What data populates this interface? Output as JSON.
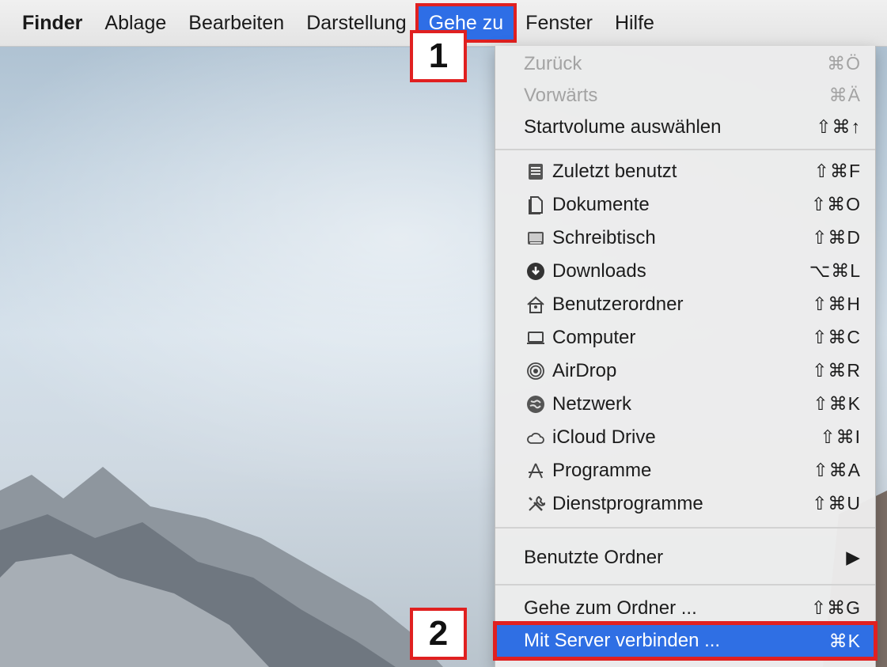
{
  "menubar": {
    "app_name": "Finder",
    "items": [
      "Ablage",
      "Bearbeiten",
      "Darstellung"
    ],
    "active_item": "Gehe zu",
    "items_after": [
      "Fenster",
      "Hilfe"
    ]
  },
  "callouts": {
    "step1": "1",
    "step2": "2"
  },
  "menu": {
    "nav": [
      {
        "label": "Zurück",
        "shortcut": "⌘Ö",
        "enabled": false
      },
      {
        "label": "Vorwärts",
        "shortcut": "⌘Ä",
        "enabled": false
      },
      {
        "label": "Startvolume auswählen",
        "shortcut": "⇧⌘↑",
        "enabled": true
      }
    ],
    "places": [
      {
        "label": "Zuletzt benutzt",
        "shortcut": "⇧⌘F",
        "icon": "recents-icon"
      },
      {
        "label": "Dokumente",
        "shortcut": "⇧⌘O",
        "icon": "documents-icon"
      },
      {
        "label": "Schreibtisch",
        "shortcut": "⇧⌘D",
        "icon": "desktop-icon"
      },
      {
        "label": "Downloads",
        "shortcut": "⌥⌘L",
        "icon": "downloads-icon"
      },
      {
        "label": "Benutzerordner",
        "shortcut": "⇧⌘H",
        "icon": "home-icon"
      },
      {
        "label": "Computer",
        "shortcut": "⇧⌘C",
        "icon": "computer-icon"
      },
      {
        "label": "AirDrop",
        "shortcut": "⇧⌘R",
        "icon": "airdrop-icon"
      },
      {
        "label": "Netzwerk",
        "shortcut": "⇧⌘K",
        "icon": "network-icon"
      },
      {
        "label": "iCloud Drive",
        "shortcut": "⇧⌘I",
        "icon": "icloud-icon"
      },
      {
        "label": "Programme",
        "shortcut": "⇧⌘A",
        "icon": "applications-icon"
      },
      {
        "label": "Dienstprogramme",
        "shortcut": "⇧⌘U",
        "icon": "utilities-icon"
      }
    ],
    "recent_folders": {
      "label": "Benutzte Ordner",
      "submenu_arrow": "▶"
    },
    "goto_folder": {
      "label": "Gehe zum Ordner ...",
      "shortcut": "⇧⌘G"
    },
    "connect_server": {
      "label": "Mit Server verbinden ...",
      "shortcut": "⌘K",
      "highlighted": true
    }
  },
  "colors": {
    "highlight": "#2f6fe4",
    "callout_border": "#e02020"
  }
}
